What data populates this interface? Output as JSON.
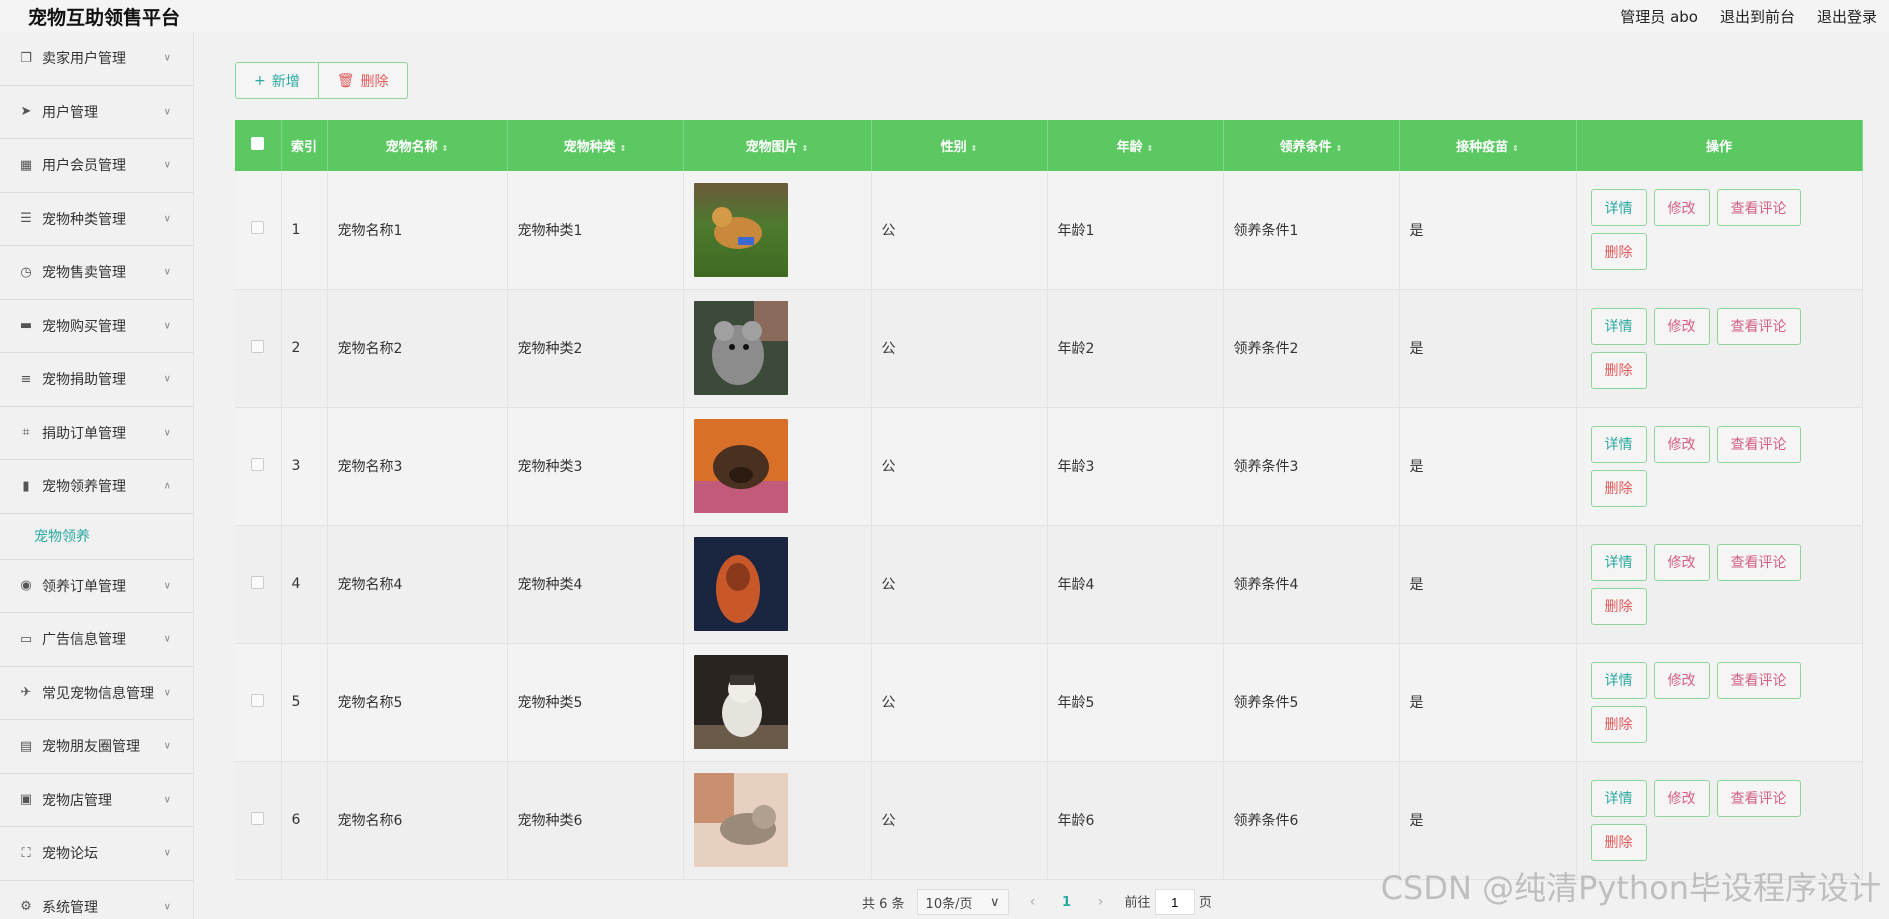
{
  "header": {
    "title": "宠物互助领售平台",
    "admin_label": "管理员 abo",
    "exit_front": "退出到前台",
    "logout": "退出登录"
  },
  "sidebar": {
    "items": [
      {
        "label": "卖家用户管理",
        "icon": "copy-icon"
      },
      {
        "label": "用户管理",
        "icon": "send-icon"
      },
      {
        "label": "用户会员管理",
        "icon": "grid-icon"
      },
      {
        "label": "宠物种类管理",
        "icon": "sliders-icon"
      },
      {
        "label": "宠物售卖管理",
        "icon": "clock-icon"
      },
      {
        "label": "宠物购买管理",
        "icon": "chat-icon"
      },
      {
        "label": "宠物捐助管理",
        "icon": "list-icon"
      },
      {
        "label": "捐助订单管理",
        "icon": "crop-icon"
      },
      {
        "label": "宠物领养管理",
        "icon": "bar-chart-icon"
      },
      {
        "label": "领养订单管理",
        "icon": "compass-icon"
      },
      {
        "label": "广告信息管理",
        "icon": "message-icon"
      },
      {
        "label": "常见宠物信息管理",
        "icon": "plane-icon"
      },
      {
        "label": "宠物朋友圈管理",
        "icon": "card-icon"
      },
      {
        "label": "宠物店管理",
        "icon": "clipboard-icon"
      },
      {
        "label": "宠物论坛",
        "icon": "fullscreen-icon"
      },
      {
        "label": "系统管理",
        "icon": "settings-icon"
      }
    ],
    "submenu_label": "宠物领养"
  },
  "toolbar": {
    "add_label": "新增",
    "delete_label": "删除"
  },
  "table": {
    "headers": [
      "索引",
      "宠物名称",
      "宠物种类",
      "宠物图片",
      "性别",
      "年龄",
      "领养条件",
      "接种疫苗",
      "操作"
    ],
    "rows": [
      {
        "index": "1",
        "name": "宠物名称1",
        "kind": "宠物种类1",
        "gender": "公",
        "age": "年龄1",
        "condition": "领养条件1",
        "vaccine": "是"
      },
      {
        "index": "2",
        "name": "宠物名称2",
        "kind": "宠物种类2",
        "gender": "公",
        "age": "年龄2",
        "condition": "领养条件2",
        "vaccine": "是"
      },
      {
        "index": "3",
        "name": "宠物名称3",
        "kind": "宠物种类3",
        "gender": "公",
        "age": "年龄3",
        "condition": "领养条件3",
        "vaccine": "是"
      },
      {
        "index": "4",
        "name": "宠物名称4",
        "kind": "宠物种类4",
        "gender": "公",
        "age": "年龄4",
        "condition": "领养条件4",
        "vaccine": "是"
      },
      {
        "index": "5",
        "name": "宠物名称5",
        "kind": "宠物种类5",
        "gender": "公",
        "age": "年龄5",
        "condition": "领养条件5",
        "vaccine": "是"
      },
      {
        "index": "6",
        "name": "宠物名称6",
        "kind": "宠物种类6",
        "gender": "公",
        "age": "年龄6",
        "condition": "领养条件6",
        "vaccine": "是"
      }
    ],
    "actions": {
      "detail": "详情",
      "edit": "修改",
      "review": "查看评论",
      "remove": "删除"
    }
  },
  "pager": {
    "total": "共 6 条",
    "page_size": "10条/页",
    "current_page": "1",
    "goto_label": "前往",
    "goto_value": "1",
    "page_suffix": "页"
  },
  "watermark": "CSDN @纯清Python毕设程序设计",
  "colors": {
    "header_green": "#5bc862",
    "accent_teal": "#2aa9a0",
    "danger": "#e05a5a"
  }
}
